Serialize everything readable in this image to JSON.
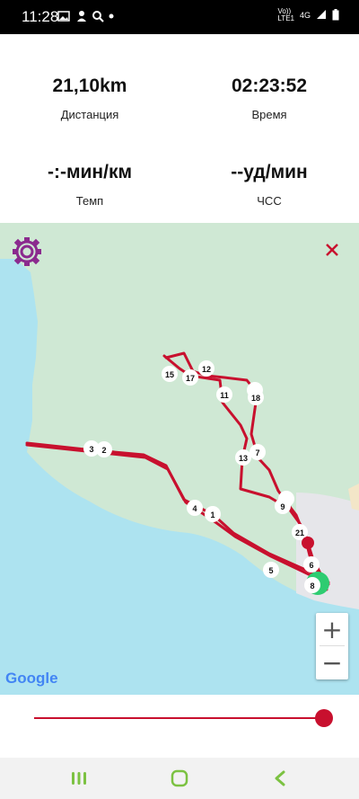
{
  "status_bar": {
    "time": "11:28",
    "network_top": "Vo))",
    "network_bottom": "LTE1",
    "network_type": "4G",
    "icons": [
      "image-icon",
      "person-icon",
      "search-icon",
      "dot-icon",
      "signal-icon",
      "battery-icon"
    ]
  },
  "stats": {
    "distance": {
      "value": "21,10km",
      "label": "Дистанция"
    },
    "time": {
      "value": "02:23:52",
      "label": "Время"
    },
    "pace": {
      "value": "-:-мин/км",
      "label": "Темп"
    },
    "heart_rate": {
      "value": "--уд/мин",
      "label": "ЧСС"
    }
  },
  "map": {
    "markers": [
      "1",
      "2",
      "3",
      "4",
      "5",
      "6",
      "7",
      "8",
      "9",
      "11",
      "12",
      "13",
      "15",
      "17",
      "18",
      "21"
    ],
    "zoom_in": "+",
    "zoom_out": "−",
    "attribution": "Google",
    "route_color": "#c8102e",
    "water_color": "#ade3f0",
    "land_color": "#cfe8d4"
  },
  "slider": {
    "progress": 1.0
  },
  "nav_bar": {
    "icons": [
      "recent-apps-icon",
      "home-icon",
      "back-icon"
    ]
  },
  "colors": {
    "accent": "#c8102e",
    "settings_icon": "#8b2a8e",
    "start_marker": "#2ecc71"
  }
}
